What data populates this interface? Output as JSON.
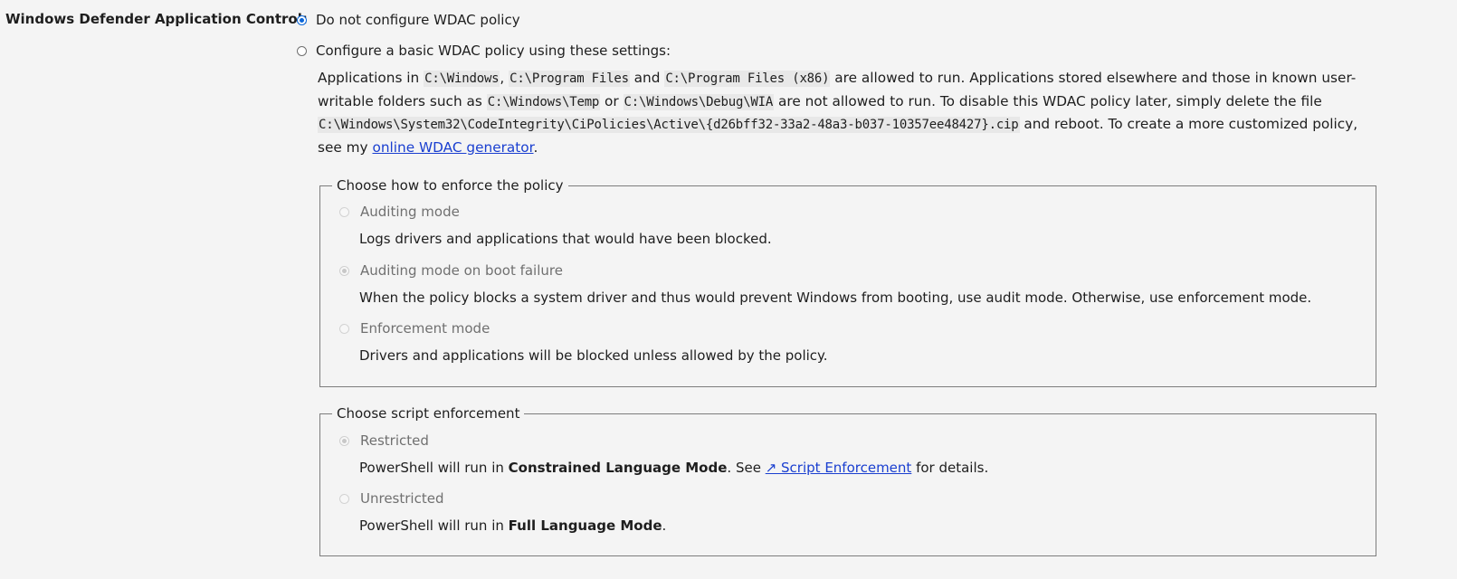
{
  "setting": {
    "label": "Windows Defender Application Control:"
  },
  "options": {
    "none_label": "Do not configure WDAC policy",
    "basic_label": "Configure a basic WDAC policy using these settings:"
  },
  "description": {
    "t1": "Applications in ",
    "c1": "C:\\Windows",
    "t2": ", ",
    "c2": "C:\\Program Files",
    "t3": " and ",
    "c3": "C:\\Program Files (x86)",
    "t4": " are allowed to run. Applications stored elsewhere and those in known user-writable folders such as ",
    "c4": "C:\\Windows\\Temp",
    "t5": " or ",
    "c5": "C:\\Windows\\Debug\\WIA",
    "t6": " are not allowed to run. To disable this WDAC policy later, simply delete the file ",
    "c6": "C:\\Windows\\System32\\CodeIntegrity\\CiPolicies\\Active\\{d26bff32-33a2-48a3-b037-10357ee48427}.cip",
    "t7": " and reboot. To create a more customized policy, see my ",
    "link": "online WDAC generator",
    "t8": "."
  },
  "enforce_group": {
    "legend": "Choose how to enforce the policy",
    "items": [
      {
        "label": "Auditing mode",
        "desc": "Logs drivers and applications that would have been blocked."
      },
      {
        "label": "Auditing mode on boot failure",
        "desc": "When the policy blocks a system driver and thus would prevent Windows from booting, use audit mode. Otherwise, use enforcement mode."
      },
      {
        "label": "Enforcement mode",
        "desc": "Drivers and applications will be blocked unless allowed by the policy."
      }
    ]
  },
  "script_group": {
    "legend": "Choose script enforcement",
    "restricted": {
      "label": "Restricted",
      "desc_pre": "PowerShell will run in ",
      "desc_bold": "Constrained Language Mode",
      "desc_mid": ". See ",
      "desc_link": "↗ Script Enforcement",
      "desc_post": " for details."
    },
    "unrestricted": {
      "label": "Unrestricted",
      "desc_pre": "PowerShell will run in ",
      "desc_bold": "Full Language Mode",
      "desc_post": "."
    }
  },
  "colors": {
    "accent": "#0a66d8",
    "link": "#1a3fd0",
    "background": "#f4f4f4"
  }
}
